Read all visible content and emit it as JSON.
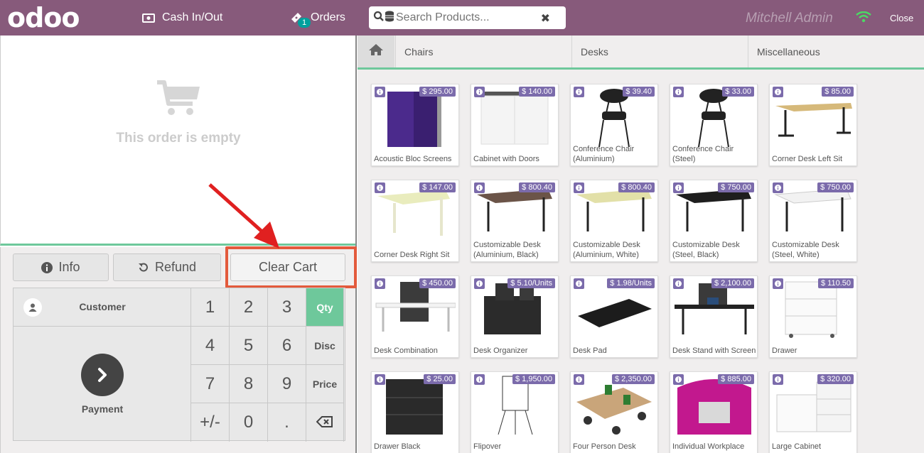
{
  "header": {
    "logo": "odoo",
    "cash_label": "Cash In/Out",
    "orders_label": "Orders",
    "orders_count": "1",
    "search_placeholder": "Search Products...",
    "user": "Mitchell Admin",
    "close_label": "Close"
  },
  "order": {
    "empty_text": "This order is empty"
  },
  "actions": {
    "info": "Info",
    "refund": "Refund",
    "clear_cart": "Clear Cart"
  },
  "numpad": {
    "customer": "Customer",
    "payment": "Payment",
    "keys": [
      "1",
      "2",
      "3",
      "4",
      "5",
      "6",
      "7",
      "8",
      "9",
      "+/-",
      "0",
      "."
    ],
    "modes": [
      "Qty",
      "Disc",
      "Price"
    ],
    "active_mode": "Qty"
  },
  "categories": [
    "Chairs",
    "Desks",
    "Miscellaneous"
  ],
  "products": [
    {
      "name": "Acoustic Bloc Screens",
      "price": "$ 295.00",
      "icon": "acoustic-screen"
    },
    {
      "name": "Cabinet with Doors",
      "price": "$ 140.00",
      "icon": "cabinet"
    },
    {
      "name": "Conference Chair (Aluminium)",
      "price": "$ 39.40",
      "icon": "chair"
    },
    {
      "name": "Conference Chair (Steel)",
      "price": "$ 33.00",
      "icon": "chair"
    },
    {
      "name": "Corner Desk Left Sit",
      "price": "$ 85.00",
      "icon": "desk-light"
    },
    {
      "name": "Corner Desk Right Sit",
      "price": "$ 147.00",
      "icon": "desk-cream"
    },
    {
      "name": "Customizable Desk (Aluminium, Black)",
      "price": "$ 800.40",
      "icon": "desk-dark"
    },
    {
      "name": "Customizable Desk (Aluminium, White)",
      "price": "$ 800.40",
      "icon": "desk-cream-black"
    },
    {
      "name": "Customizable Desk (Steel, Black)",
      "price": "$ 750.00",
      "icon": "desk-black"
    },
    {
      "name": "Customizable Desk (Steel, White)",
      "price": "$ 750.00",
      "icon": "desk-white"
    },
    {
      "name": "Desk Combination",
      "price": "$ 450.00",
      "icon": "desk-combo"
    },
    {
      "name": "Desk Organizer",
      "price": "$ 5.10/Units",
      "icon": "organizer"
    },
    {
      "name": "Desk Pad",
      "price": "$ 1.98/Units",
      "icon": "pad"
    },
    {
      "name": "Desk Stand with Screen",
      "price": "$ 2,100.00",
      "icon": "desk-stand"
    },
    {
      "name": "Drawer",
      "price": "$ 110.50",
      "icon": "drawer"
    },
    {
      "name": "Drawer Black",
      "price": "$ 25.00",
      "icon": "drawer-black"
    },
    {
      "name": "Flipover",
      "price": "$ 1,950.00",
      "icon": "flipover"
    },
    {
      "name": "Four Person Desk",
      "price": "$ 2,350.00",
      "icon": "four-desk"
    },
    {
      "name": "Individual Workplace",
      "price": "$ 885.00",
      "icon": "workplace"
    },
    {
      "name": "Large Cabinet",
      "price": "$ 320.00",
      "icon": "large-cabinet"
    }
  ],
  "colors": {
    "header": "#875a7b",
    "accent": "#6ec89b",
    "price_badge": "#7b6bab",
    "highlight": "#e35a3c"
  }
}
